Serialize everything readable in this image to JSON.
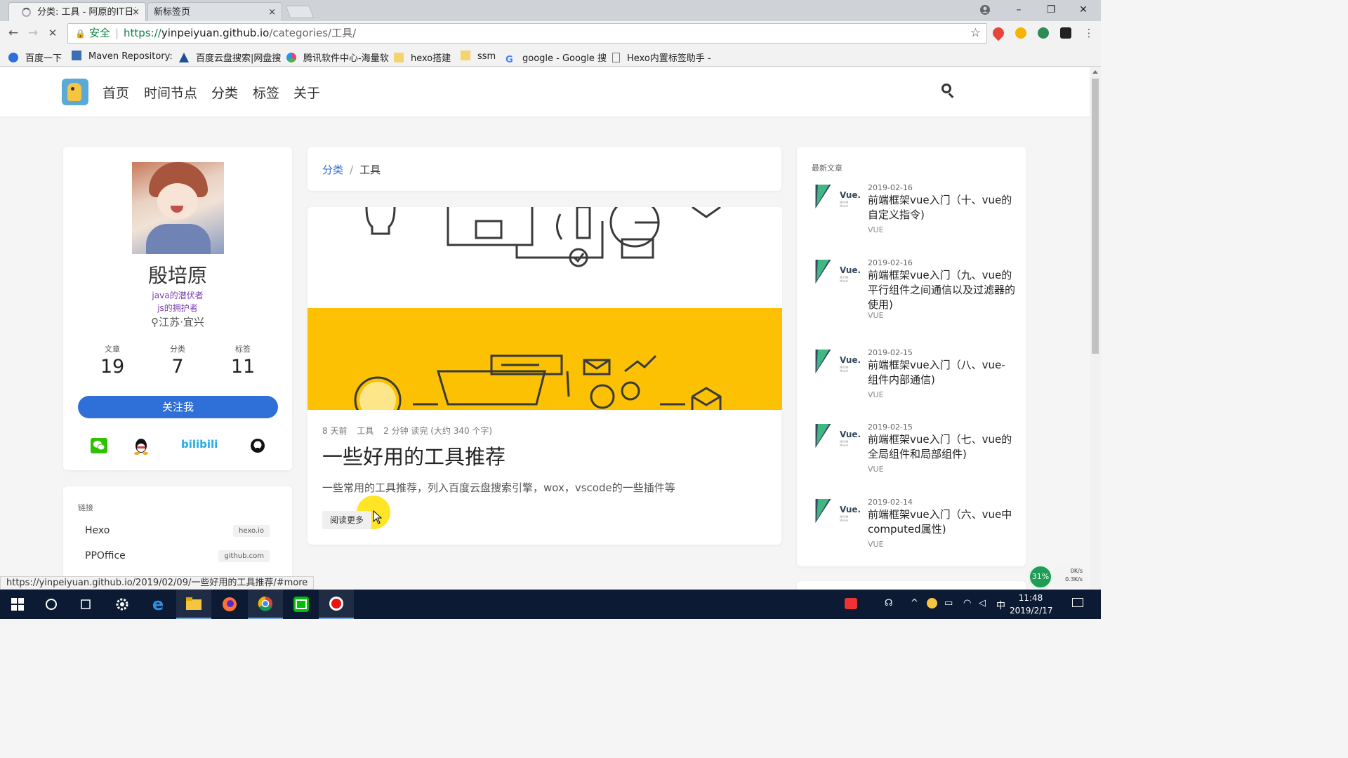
{
  "browser": {
    "tabs": [
      {
        "title": "分类: 工具 - 阿原的IT日记",
        "close": "×"
      },
      {
        "title": "新标签页",
        "close": "×"
      }
    ],
    "window_controls": {
      "minimize": "–",
      "restore": "❐",
      "close": "✕"
    },
    "nav": {
      "back": "←",
      "forward": "→",
      "stop": "✕"
    },
    "address": {
      "secure_label": "安全",
      "url_prefix": "https://",
      "url_host": "yinpeiyuan.github.io",
      "url_path": "/categories/工具/"
    },
    "bookmarks": [
      {
        "label": "百度一下",
        "icon": "baidu-icon",
        "color": "#2f6fd8"
      },
      {
        "label": "Maven Repository:",
        "icon": "maven-icon",
        "color": "#3c6eb4"
      },
      {
        "label": "百度云盘搜索|网盘搜",
        "icon": "cloud-search-icon",
        "color": "#1b4f9c"
      },
      {
        "label": "腾讯软件中心-海量软",
        "icon": "tencent-icon",
        "color": "#e0457b"
      },
      {
        "label": "hexo搭建",
        "icon": "folder-icon",
        "color": "#f4c542"
      },
      {
        "label": "ssm",
        "icon": "folder-icon",
        "color": "#f4c542"
      },
      {
        "label": "google - Google 搜",
        "icon": "google-icon",
        "color": "#4285f4"
      },
      {
        "label": "Hexo内置标签助手 -",
        "icon": "page-icon",
        "color": "#777777"
      }
    ],
    "status_url": "https://yinpeiyuan.github.io/2019/02/09/一些好用的工具推荐/#more"
  },
  "site": {
    "nav": [
      "首页",
      "时间节点",
      "分类",
      "标签",
      "关于"
    ]
  },
  "profile": {
    "name": "殷培原",
    "line1": "java的潜伏者",
    "line2": "js的拥护者",
    "location": "江苏·宜兴",
    "stats": [
      {
        "label": "文章",
        "value": "19"
      },
      {
        "label": "分类",
        "value": "7"
      },
      {
        "label": "标签",
        "value": "11"
      }
    ],
    "follow_label": "关注我",
    "social": [
      "wechat-icon",
      "qq-icon",
      "bilibili-icon",
      "github-icon"
    ],
    "bilibili_text": "bilibili"
  },
  "links": {
    "heading": "链接",
    "items": [
      {
        "name": "Hexo",
        "domain": "hexo.io"
      },
      {
        "name": "PPOffice",
        "domain": "github.com"
      }
    ]
  },
  "breadcrumb": {
    "parent": "分类",
    "separator": "/",
    "current": "工具"
  },
  "post": {
    "meta": {
      "time": "8 天前",
      "category": "工具",
      "reading": "2 分钟 读完 (大约 340 个字)"
    },
    "title": "一些好用的工具推荐",
    "excerpt": "一些常用的工具推荐，列入百度云盘搜索引擎，wox，vscode的一些插件等",
    "read_more": "阅读更多",
    "cover_colors": {
      "top": "#ffffff",
      "bottom": "#fbc102",
      "line": "#3a3a3a"
    }
  },
  "recent": {
    "heading": "最新文章",
    "thumb_text": "Vue.",
    "thumb_sub": "MVVM Model",
    "items": [
      {
        "date": "2019-02-16",
        "title": "前端框架vue入门（十、vue的自定义指令)",
        "tag": "VUE"
      },
      {
        "date": "2019-02-16",
        "title": "前端框架vue入门（九、vue的平行组件之间通信以及过滤器的使用)",
        "tag": "VUE"
      },
      {
        "date": "2019-02-15",
        "title": "前端框架vue入门（八、vue-组件内部通信)",
        "tag": "VUE"
      },
      {
        "date": "2019-02-15",
        "title": "前端框架vue入门（七、vue的全局组件和局部组件)",
        "tag": "VUE"
      },
      {
        "date": "2019-02-14",
        "title": "前端框架vue入门（六、vue中computed属性)",
        "tag": "VUE"
      }
    ]
  },
  "widget": {
    "cpu": "31%",
    "up": "0K/s",
    "down": "0.3K/s"
  },
  "taskbar": {
    "apps": [
      "start-icon",
      "cortana-icon",
      "task-view-icon",
      "settings-icon",
      "edge-icon",
      "file-explorer-icon",
      "firefox-icon",
      "chrome-icon",
      "iqiyi-icon",
      "record-icon"
    ],
    "ime": "中",
    "time": "11:48",
    "date": "2019/2/17"
  }
}
